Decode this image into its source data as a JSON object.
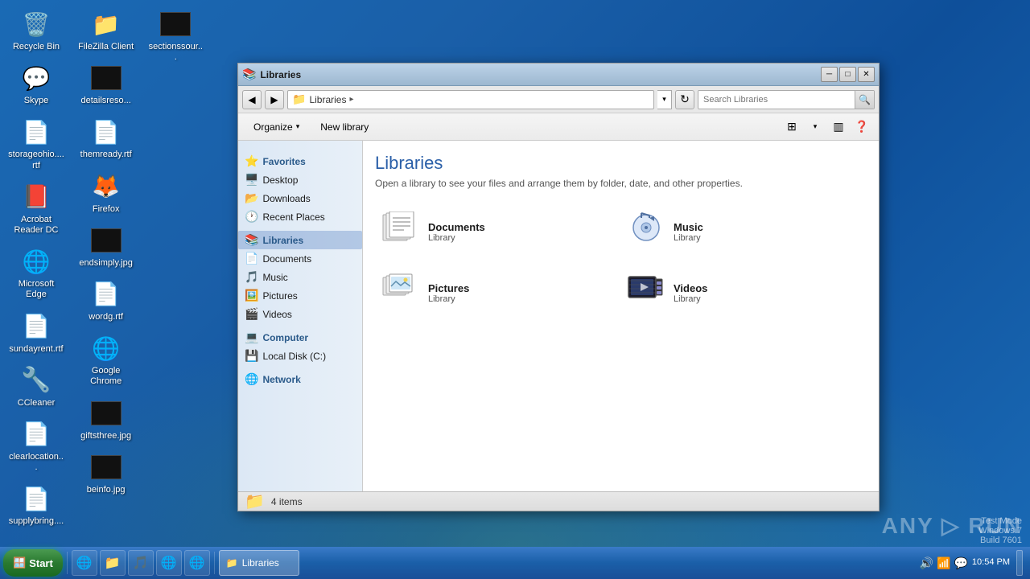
{
  "desktop": {
    "icons": [
      {
        "id": "recycle-bin",
        "label": "Recycle Bin",
        "icon": "🗑️"
      },
      {
        "id": "skype",
        "label": "Skype",
        "icon": "💬"
      },
      {
        "id": "storageohio",
        "label": "storageohio....rtf",
        "icon": "📄"
      },
      {
        "id": "acrobat",
        "label": "Acrobat Reader DC",
        "icon": "📕"
      },
      {
        "id": "edge",
        "label": "Microsoft Edge",
        "icon": "🌐"
      },
      {
        "id": "sundayrent",
        "label": "sundayrent.rtf",
        "icon": "📄"
      },
      {
        "id": "ccleaner",
        "label": "CCleaner",
        "icon": "🔧"
      },
      {
        "id": "clearlocation",
        "label": "clearlocation...",
        "icon": "📄"
      },
      {
        "id": "supplybring",
        "label": "supplybring....",
        "icon": "📄"
      },
      {
        "id": "filezilla",
        "label": "FileZilla Client",
        "icon": "📁"
      },
      {
        "id": "detailsreso",
        "label": "detailsreso...",
        "icon": "⬛"
      },
      {
        "id": "themready",
        "label": "themready.rtf",
        "icon": "📄"
      },
      {
        "id": "firefox",
        "label": "Firefox",
        "icon": "🦊"
      },
      {
        "id": "endsimply",
        "label": "endsimply.jpg",
        "icon": "⬛"
      },
      {
        "id": "wordg",
        "label": "wordg.rtf",
        "icon": "📄"
      },
      {
        "id": "chrome",
        "label": "Google Chrome",
        "icon": "🌐"
      },
      {
        "id": "giftsthree",
        "label": "giftsthree.jpg",
        "icon": "⬛"
      },
      {
        "id": "beinfo",
        "label": "beinfo.jpg",
        "icon": "⬛"
      },
      {
        "id": "sectionssour",
        "label": "sectionssour...",
        "icon": "⬛"
      }
    ]
  },
  "window": {
    "title": "Libraries",
    "title_icon": "📚",
    "address": {
      "path": "Libraries",
      "folder_icon": "📁"
    },
    "search": {
      "placeholder": "Search Libraries"
    },
    "toolbar": {
      "organize_label": "Organize",
      "new_library_label": "New library"
    },
    "sidebar": {
      "sections": [
        {
          "name": "Favorites",
          "icon": "⭐",
          "is_header": true,
          "items": [
            {
              "label": "Desktop",
              "icon": "🖥️"
            },
            {
              "label": "Downloads",
              "icon": "📂"
            },
            {
              "label": "Recent Places",
              "icon": "🕐"
            }
          ]
        },
        {
          "name": "Libraries",
          "icon": "📚",
          "is_header": true,
          "active": true,
          "items": [
            {
              "label": "Documents",
              "icon": "📄"
            },
            {
              "label": "Music",
              "icon": "🎵"
            },
            {
              "label": "Pictures",
              "icon": "🖼️"
            },
            {
              "label": "Videos",
              "icon": "🎬"
            }
          ]
        },
        {
          "name": "Computer",
          "icon": "💻",
          "is_header": true,
          "items": [
            {
              "label": "Local Disk (C:)",
              "icon": "💾"
            }
          ]
        },
        {
          "name": "Network",
          "icon": "🌐",
          "is_header": true,
          "items": []
        }
      ]
    },
    "content": {
      "title": "Libraries",
      "subtitle": "Open a library to see your files and arrange them by folder, date, and other properties.",
      "libraries": [
        {
          "name": "Documents",
          "type": "Library",
          "icon": "📋"
        },
        {
          "name": "Music",
          "type": "Library",
          "icon": "🎵"
        },
        {
          "name": "Pictures",
          "type": "Library",
          "icon": "🖼️"
        },
        {
          "name": "Videos",
          "type": "Library",
          "icon": "🎬"
        }
      ]
    },
    "status": {
      "count": "4 items"
    }
  },
  "taskbar": {
    "start_label": "Start",
    "tasks": [
      {
        "label": "Libraries",
        "icon": "📁",
        "active": true
      }
    ],
    "quick_launch": [
      {
        "icon": "🌐",
        "label": "IE"
      },
      {
        "icon": "📁",
        "label": "Explorer"
      },
      {
        "icon": "🎵",
        "label": "Media Player"
      },
      {
        "icon": "🌐",
        "label": "Chrome"
      },
      {
        "icon": "🌐",
        "label": "Edge"
      }
    ],
    "clock": {
      "time": "10:54 PM",
      "date": ""
    }
  },
  "watermark": {
    "text": "ANY ▷ RUN",
    "mode": "Test Mode",
    "os": "Windows 7",
    "build": "Build 7601"
  }
}
